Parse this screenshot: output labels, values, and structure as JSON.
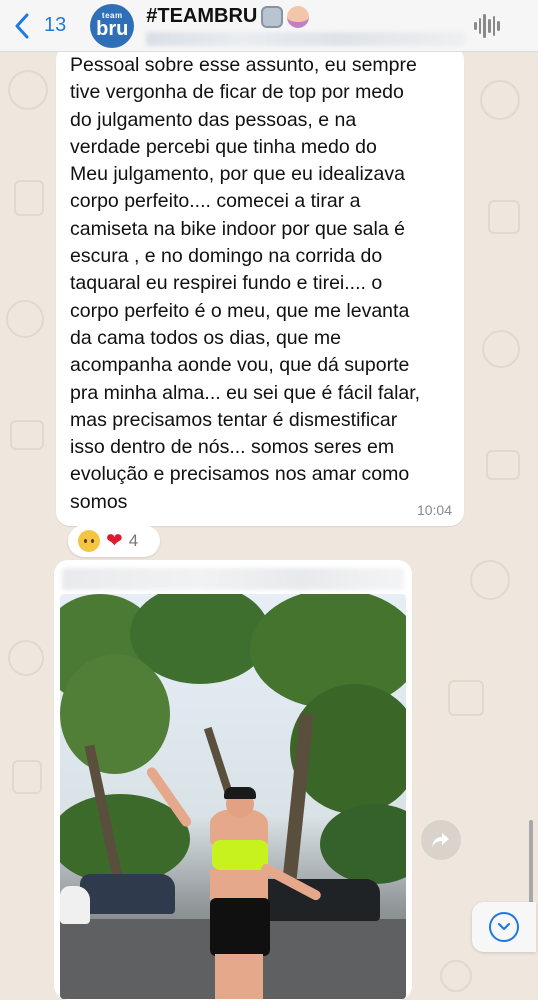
{
  "header": {
    "back_count": "13",
    "avatar_top": "team",
    "avatar_main": "bru",
    "title": "#TEAMBRU"
  },
  "message": {
    "text": "Pessoal sobre esse assunto, eu sempre\ntive vergonha de ficar de top por medo\ndo julgamento das pessoas, e na\nverdade percebi que tinha medo do\nMeu julgamento, por que eu idealizava\ncorpo perfeito.... comecei a tirar a\ncamiseta na bike indoor por que sala é\nescura , e no domingo na corrida do\ntaquaral eu respirei fundo e tirei.... o\ncorpo perfeito é o meu, que me levanta\nda cama todos os dias, que me\nacompanha aonde vou, que dá suporte\npra minha alma... eu sei que é fácil falar,\nmas precisamos tentar é dismestificar\nisso dentro de nós... somos seres em\nevolução e precisamos nos amar como\nsomos",
    "time": "10:04",
    "reaction_count": "4"
  },
  "icons": {
    "back": "chevron-left-icon",
    "audio": "waveform-icon",
    "forward": "share-forward-icon",
    "scroll": "chevron-down-icon"
  },
  "colors": {
    "accent": "#1f7ae0",
    "background": "#efe7de",
    "bubble": "#ffffff",
    "top_neon": "#c6f21e"
  }
}
